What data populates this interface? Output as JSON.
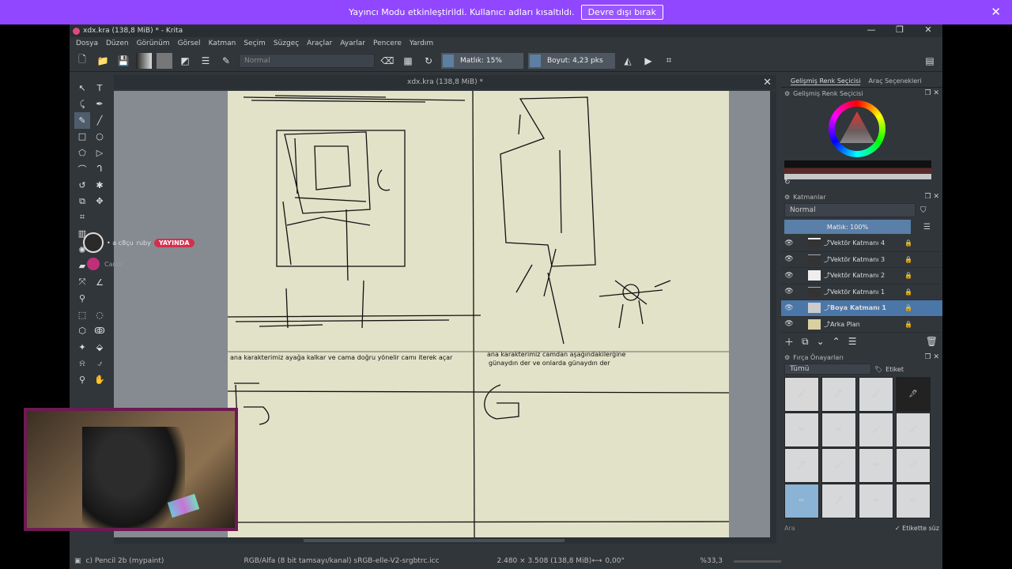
{
  "banner": {
    "text": "Yayıncı Modu etkinleştirildi. Kullanıcı adları kısaltıldı.",
    "button": "Devre dışı bırak"
  },
  "window": {
    "title": "xdx.kra (138,8 MiB) * - Krita"
  },
  "menu": [
    "Dosya",
    "Düzen",
    "Görünüm",
    "Görsel",
    "Katman",
    "Seçim",
    "Süzgeç",
    "Araçlar",
    "Ayarlar",
    "Pencere",
    "Yardım"
  ],
  "toolbar": {
    "blend_mode": "Normal",
    "opacity": "Matlık: 15%",
    "size": "Boyut: 4,23 pks"
  },
  "canvas": {
    "tab_title": "xdx.kra (138,8 MiB) *"
  },
  "panels": {
    "text_top_left": "ana karakterimiz ayağa kalkar ve cama doğru yönelir camı iterek açar",
    "text_top_right_1": "ana karakterimiz camdan aşağındakilerğine",
    "text_top_right_2": "günaydın der ve onlarda günaydın der"
  },
  "dock": {
    "tabs": [
      "Gelişmiş Renk Seçicisi",
      "Araç Seçenekleri"
    ],
    "color_selector_title": "Gelişmiş Renk Seçicisi",
    "layers_title": "Katmanlar",
    "layers_blend": "Normal",
    "layers_opacity": "Matlık:  100%",
    "layers": [
      {
        "name": "Vektör Katmanı 4",
        "selected": false
      },
      {
        "name": "Vektör Katmanı 3",
        "selected": false
      },
      {
        "name": "Vektör Katmanı 2",
        "selected": false
      },
      {
        "name": "Vektör Katmanı 1",
        "selected": false
      },
      {
        "name": "Boya Katmanı 1",
        "selected": true
      },
      {
        "name": "Arka Plan",
        "selected": false
      }
    ],
    "brushes_title": "Fırça Önayarları",
    "brushes_filter": "Tümü",
    "brushes_tag": "Etiket",
    "search_placeholder": "Ara",
    "filter_in_tag": "Etikette süz"
  },
  "status": {
    "brush": "c) Pencil 2b (mypaint)",
    "color_space": "RGB/Alfa (8 bit tamsayı/kanal)  sRGB-elle-V2-srgbtrc.icc",
    "dimensions": "2.480 × 3.508 (138,8 MiB)",
    "rotation": "0,00°",
    "zoom": "%33,3"
  },
  "overlay": {
    "streamer": "• a c8çu",
    "badge_name": "ruby",
    "live": "YAYINDA",
    "user2": "Canol"
  }
}
